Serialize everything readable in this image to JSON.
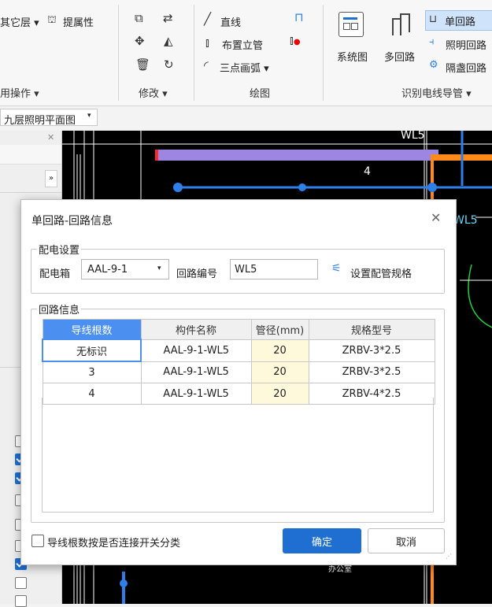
{
  "ribbon": {
    "other_layer": "其它层",
    "extract_attr": "提属性",
    "group_labels": {
      "ops": "用操作",
      "modify": "修改",
      "draw": "绘图",
      "identify": "识别电线导管"
    },
    "draw_items": {
      "line": "直线",
      "place_riser": "布置立管",
      "arc": "三点画弧"
    },
    "identify_items": {
      "system_diagram": "系统图",
      "multi_circuit": "多回路",
      "single_circuit": "单回路",
      "lighting_circuit": "照明回路",
      "box_circuit": "隔盏回路"
    }
  },
  "doc_tab": {
    "label": "九层照明平面图"
  },
  "canvas": {
    "label_wl5_top": "WL5",
    "label_4": "4",
    "label_wl5_right": "WL5",
    "label_bottom": "办公室"
  },
  "dialog": {
    "title": "单回路-回路信息",
    "power_settings": {
      "legend": "配电设置",
      "box_label": "配电箱",
      "box_value": "AAL-9-1",
      "number_label": "回路编号",
      "number_value": "WL5",
      "pipe_spec_button": "设置配管规格"
    },
    "circuit_info": {
      "legend": "回路信息",
      "columns": [
        "导线根数",
        "构件名称",
        "管径(mm)",
        "规格型号"
      ],
      "rows": [
        [
          "无标识",
          "AAL-9-1-WL5",
          "20",
          "ZRBV-3*2.5"
        ],
        [
          "3",
          "AAL-9-1-WL5",
          "20",
          "ZRBV-3*2.5"
        ],
        [
          "4",
          "AAL-9-1-WL5",
          "20",
          "ZRBV-4*2.5"
        ]
      ]
    },
    "checkbox_label": "导线根数按是否连接开关分类",
    "ok": "确定",
    "cancel": "取消"
  },
  "colors": {
    "primary": "#1e6fd1",
    "header_selected": "#4b8ff0",
    "pipe_cell": "#fff9dc",
    "wire_purple": "#9d86e2",
    "wire_orange": "#ff8a1a",
    "wire_blue": "#2f7fe8"
  },
  "icons": [
    "search-icon",
    "close-icon",
    "chevron-down-icon",
    "pipe-spec-icon",
    "checkbox-icon"
  ]
}
